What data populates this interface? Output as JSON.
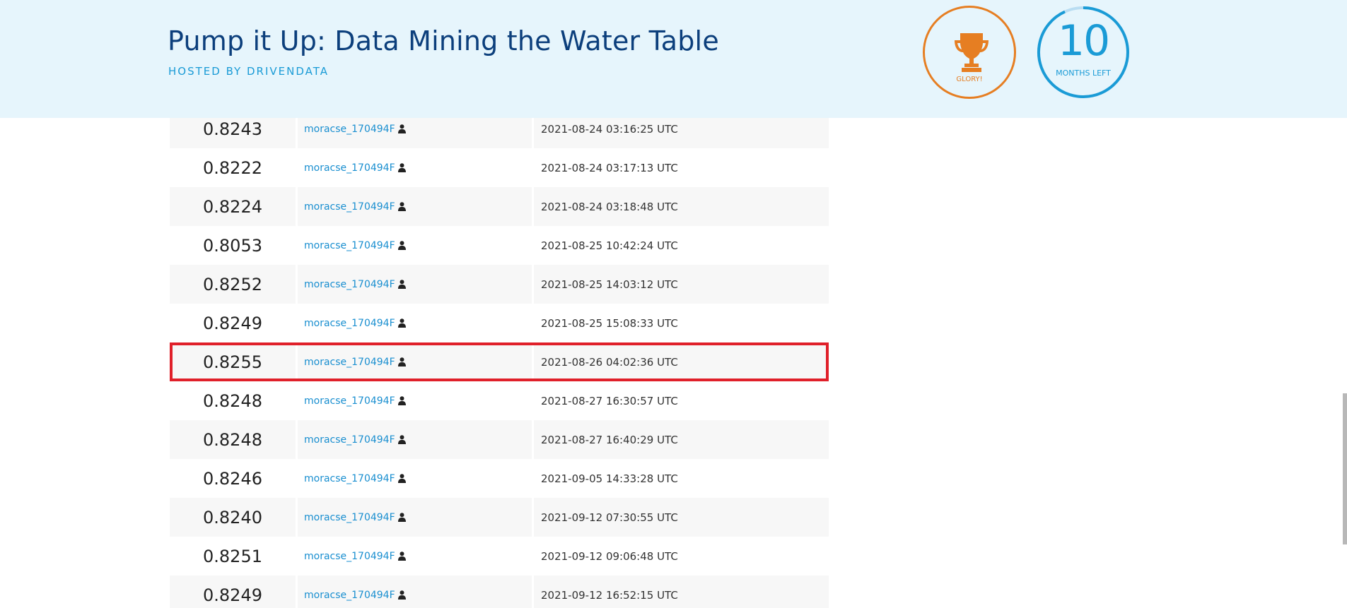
{
  "header": {
    "title": "Pump it Up: Data Mining the Water Table",
    "hosted_by": "HOSTED BY DRIVENDATA",
    "glory_label": "GLORY!",
    "months_number": "10",
    "months_label": "MONTHS LEFT"
  },
  "colors": {
    "accent_blue": "#1a9bd6",
    "title_blue": "#0c3f7c",
    "glory_orange": "#e67e22",
    "highlight_red": "#e0202a",
    "header_bg": "#e6f5fc"
  },
  "icons": {
    "trophy": "trophy-icon",
    "person": "person-icon"
  },
  "submissions": [
    {
      "score": "0.8243",
      "user": "moracse_170494F",
      "time": "2021-08-24 03:16:25 UTC"
    },
    {
      "score": "0.8222",
      "user": "moracse_170494F",
      "time": "2021-08-24 03:17:13 UTC"
    },
    {
      "score": "0.8224",
      "user": "moracse_170494F",
      "time": "2021-08-24 03:18:48 UTC"
    },
    {
      "score": "0.8053",
      "user": "moracse_170494F",
      "time": "2021-08-25 10:42:24 UTC"
    },
    {
      "score": "0.8252",
      "user": "moracse_170494F",
      "time": "2021-08-25 14:03:12 UTC"
    },
    {
      "score": "0.8249",
      "user": "moracse_170494F",
      "time": "2021-08-25 15:08:33 UTC"
    },
    {
      "score": "0.8255",
      "user": "moracse_170494F",
      "time": "2021-08-26 04:02:36 UTC"
    },
    {
      "score": "0.8248",
      "user": "moracse_170494F",
      "time": "2021-08-27 16:30:57 UTC"
    },
    {
      "score": "0.8248",
      "user": "moracse_170494F",
      "time": "2021-08-27 16:40:29 UTC"
    },
    {
      "score": "0.8246",
      "user": "moracse_170494F",
      "time": "2021-09-05 14:33:28 UTC"
    },
    {
      "score": "0.8240",
      "user": "moracse_170494F",
      "time": "2021-09-12 07:30:55 UTC"
    },
    {
      "score": "0.8251",
      "user": "moracse_170494F",
      "time": "2021-09-12 09:06:48 UTC"
    },
    {
      "score": "0.8249",
      "user": "moracse_170494F",
      "time": "2021-09-12 16:52:15 UTC"
    }
  ],
  "highlighted_row": 6
}
